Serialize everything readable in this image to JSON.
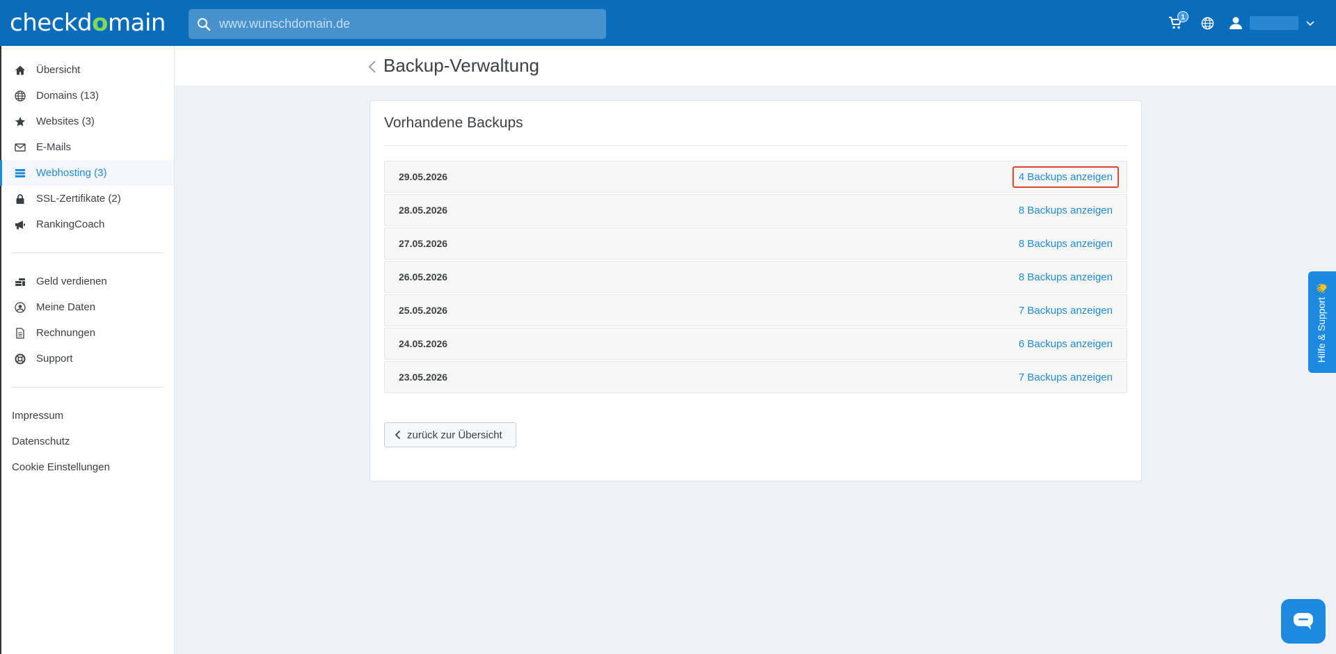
{
  "header": {
    "logo_text_1": "checkd",
    "logo_text_check": "o",
    "logo_text_2": "main",
    "search_placeholder": "www.wunschdomain.de",
    "cart_count": "1",
    "icons": [
      "search-icon",
      "cart-icon",
      "globe-icon",
      "user-icon",
      "chevron-down-icon"
    ]
  },
  "sidebar": {
    "nav": [
      {
        "label": "Übersicht",
        "icon": "home-icon"
      },
      {
        "label": "Domains (13)",
        "icon": "globe-icon"
      },
      {
        "label": "Websites (3)",
        "icon": "star-icon"
      },
      {
        "label": "E-Mails",
        "icon": "mail-icon"
      },
      {
        "label": "Webhosting (3)",
        "icon": "list-icon",
        "active": true
      },
      {
        "label": "SSL-Zertifikate (2)",
        "icon": "lock-icon"
      },
      {
        "label": "RankingCoach",
        "icon": "megaphone-icon"
      }
    ],
    "account": [
      {
        "label": "Geld verdienen",
        "icon": "coins-icon"
      },
      {
        "label": "Meine Daten",
        "icon": "user-circle-icon"
      },
      {
        "label": "Rechnungen",
        "icon": "document-icon"
      },
      {
        "label": "Support",
        "icon": "lifebuoy-icon"
      }
    ],
    "footer": [
      {
        "label": "Impressum"
      },
      {
        "label": "Datenschutz"
      },
      {
        "label": "Cookie Einstellungen"
      }
    ]
  },
  "page": {
    "title": "Backup-Verwaltung"
  },
  "card": {
    "title": "Vorhandene Backups",
    "rows": [
      {
        "date": "29.05.2026",
        "link": "4 Backups anzeigen"
      },
      {
        "date": "28.05.2026",
        "link": "8 Backups anzeigen"
      },
      {
        "date": "27.05.2026",
        "link": "8 Backups anzeigen"
      },
      {
        "date": "26.05.2026",
        "link": "8 Backups anzeigen"
      },
      {
        "date": "25.05.2026",
        "link": "7 Backups anzeigen"
      },
      {
        "date": "24.05.2026",
        "link": "6 Backups anzeigen"
      },
      {
        "date": "23.05.2026",
        "link": "7 Backups anzeigen"
      }
    ],
    "back_button": "zurück zur Übersicht"
  },
  "help": {
    "tab_label": "Hilfe & Support 👋"
  },
  "colors": {
    "topbar": "#0a6dbc",
    "accent": "#1f8ad8",
    "highlight": "#e0462e"
  }
}
